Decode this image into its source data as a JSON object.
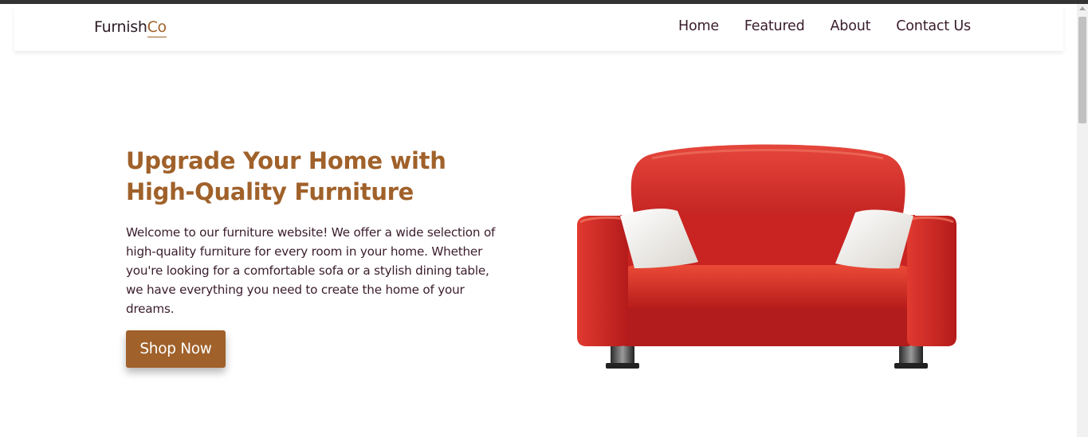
{
  "header": {
    "logo_main": "Furnish",
    "logo_accent": "Co",
    "nav": [
      "Home",
      "Featured",
      "About",
      "Contact Us"
    ]
  },
  "hero": {
    "title": "Upgrade Your Home with High-Quality Furniture",
    "description": "Welcome to our furniture website! We offer a wide selection of high-quality furniture for every room in your home. Whether you're looking for a comfortable sofa or a stylish dining table, we have everything you need to create the home of your dreams.",
    "cta_label": "Shop Now"
  },
  "colors": {
    "accent": "#a0612a",
    "text": "#3a1c2c",
    "sofa_red": "#d42a28"
  }
}
